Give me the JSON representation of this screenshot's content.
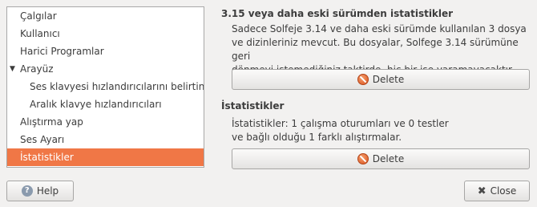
{
  "sidebar": {
    "items": [
      {
        "label": "Çalgılar"
      },
      {
        "label": "Kullanıcı"
      },
      {
        "label": "Harici Programlar"
      },
      {
        "label": "Arayüz",
        "expander": "▼"
      },
      {
        "label": "Ses klavyesi hızlandırıcılarını belirtin"
      },
      {
        "label": "Aralık klavye hızlandırıcıları"
      },
      {
        "label": "Alıştırma yap"
      },
      {
        "label": "Ses Ayarı"
      },
      {
        "label": "İstatistikler"
      }
    ]
  },
  "old_stats": {
    "title": "3.15 veya daha eski sürümden istatistikler",
    "lines": [
      "Sadece Solfeje 3.14 ve daha eski sürümde kullanılan 3 dosya",
      "ve dizinleriniz mevcut. Bu dosyalar, Solfege 3.14 sürümüne geri",
      "dönmeyi istemediğiniz taktirde, hiç bir işe yaramayacaktır."
    ],
    "delete_label": "Delete"
  },
  "stats": {
    "title": "İstatistikler",
    "lines": [
      "İstatistikler: 1 çalışma oturumları ve 0 testler",
      "ve bağlı olduğu 1 farklı alıştırmalar."
    ],
    "delete_label": "Delete"
  },
  "footer": {
    "help_label": "Help",
    "close_label": "Close"
  },
  "colors": {
    "selection": "#f07746",
    "window_bg": "#f2f1f0"
  }
}
